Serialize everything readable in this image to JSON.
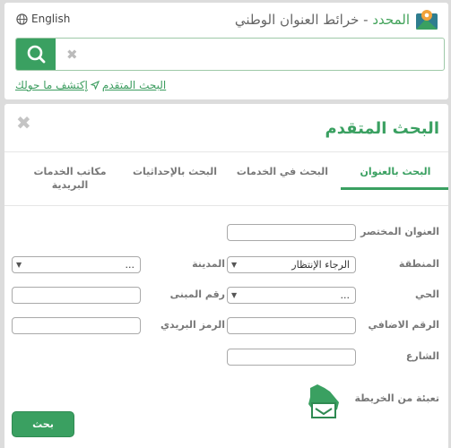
{
  "header": {
    "language_label": "English",
    "title_accent": "المحدد",
    "title_rest": "- خرائط العنوان الوطني"
  },
  "search": {
    "placeholder": "",
    "clear_glyph": "✖"
  },
  "links": {
    "explore_label": "إكتشف ما حولك",
    "advanced_label": "البحث المتقدم"
  },
  "panel": {
    "title": "البحث المتقدم",
    "close_glyph": "✖",
    "tabs": [
      {
        "label": "البحث بالعنوان"
      },
      {
        "label": "البحث في الخدمات"
      },
      {
        "label": "البحث بالإحداثيات"
      },
      {
        "label": "مكاتب الخدمات البريدية"
      }
    ],
    "active_tab": 0
  },
  "form": {
    "short_address_label": "العنوان المختصر",
    "region_label": "المنطقة",
    "region_value": "الرجاء الإنتظار",
    "city_label": "المدينة",
    "city_value": "...",
    "district_label": "الحي",
    "district_value": "...",
    "building_number_label": "رقم المبنى",
    "additional_number_label": "الرقم الاضافي",
    "postal_code_label": "الرمز البريدي",
    "street_label": "الشارع",
    "map_fill_label": "تعبئة من الخريطة",
    "submit_label": "بحث"
  },
  "colors": {
    "accent": "#3aa061",
    "background": "#dcdcdc",
    "label": "#777777"
  },
  "icons": {
    "language": "globe-icon",
    "logo": "map-pin-logo-icon",
    "search": "search-icon",
    "clear": "close-icon",
    "explore": "navigation-arrow-icon",
    "map": "saudi-map-icon"
  }
}
